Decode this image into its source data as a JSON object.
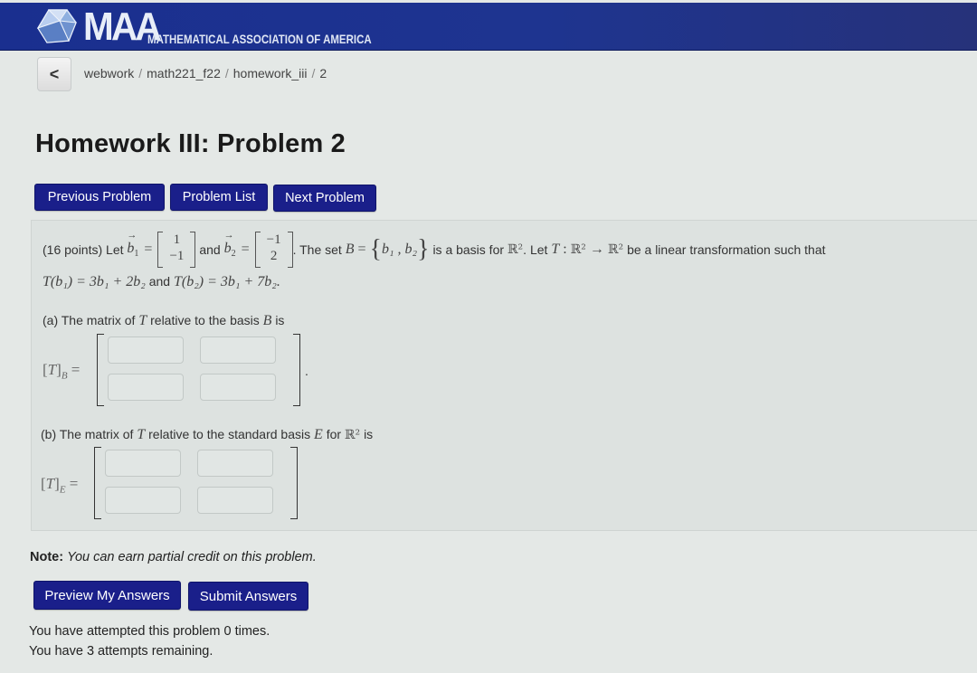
{
  "header": {
    "logo_text": "MAA",
    "logo_subtitle": "MATHEMATICAL ASSOCIATION OF AMERICA",
    "brand_color": "#1a2f8f"
  },
  "nav": {
    "back_icon": "chevron-left-icon",
    "back_glyph": "<",
    "breadcrumb": [
      "webwork",
      "math221_f22",
      "homework_iii",
      "2"
    ],
    "separator": "/"
  },
  "page": {
    "title": "Homework III: Problem 2"
  },
  "problem_nav": {
    "previous": "Previous Problem",
    "list": "Problem List",
    "next": "Next Problem",
    "button_color": "#1a1f8a"
  },
  "problem": {
    "intro_prefix": "(16 points) Let",
    "b1_name": "b",
    "b1_sub": "1",
    "b1": [
      "1",
      "−1"
    ],
    "and_text": "and",
    "b2_name": "b",
    "b2_sub": "2",
    "b2": [
      "−1",
      "2"
    ],
    "set_prefix": ". The set",
    "set_name": "B",
    "equals": "=",
    "set_members": "b₁ , b₂",
    "basis_text": "is a basis for",
    "R2": "ℝ²",
    "let_text": ". Let",
    "T": "T",
    "colon": ":",
    "arrow": "→",
    "linear_text": "be a linear transformation such that",
    "line2_left": "T(b₁) = 3b₁ + 2b₂",
    "line2_and": "and",
    "line2_right": "T(b₂) = 3b₁ + 7b₂.",
    "part_a": {
      "text_prefix": "(a) The matrix of",
      "text_mid": "relative to the basis",
      "text_var": "B",
      "text_suffix": "is",
      "label_T": "T",
      "label_sub": "B",
      "cells": [
        "",
        "",
        "",
        ""
      ],
      "trailing": "."
    },
    "part_b": {
      "text_prefix": "(b) The matrix of",
      "text_mid": "relative to the standard basis",
      "text_var": "E",
      "text_for": "for",
      "text_suffix": "is",
      "label_T": "T",
      "label_sub": "E",
      "cells": [
        "",
        "",
        "",
        ""
      ]
    }
  },
  "note": {
    "label": "Note:",
    "text": "You can earn partial credit on this problem."
  },
  "actions": {
    "preview": "Preview My Answers",
    "submit": "Submit Answers"
  },
  "attempts": {
    "line1": "You have attempted this problem 0 times.",
    "line2": "You have 3 attempts remaining."
  }
}
